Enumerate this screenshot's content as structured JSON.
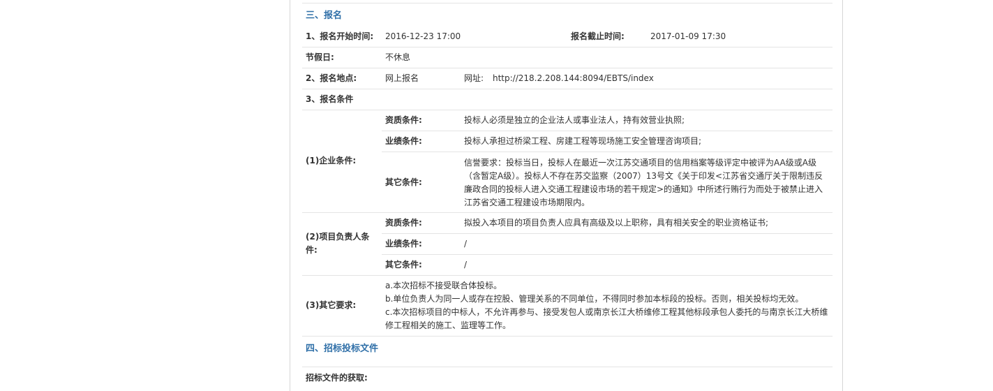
{
  "section3": {
    "title": "三、报名",
    "start_label": "1、报名开始时间:",
    "start_value": "2016-12-23 17:00",
    "end_label": "报名截止时间:",
    "end_value": "2017-01-09 17:30",
    "holiday_label": "节假日:",
    "holiday_value": "不休息",
    "place_label": "2、报名地点:",
    "place_value": "网上报名",
    "url_label": "网址:",
    "url_value": "http://218.2.208.144:8094/EBTS/index",
    "conditions_label": "3、报名条件",
    "enterprise": {
      "label": "(1)企业条件:",
      "qual_label": "资质条件:",
      "qual_value": "投标人必须是独立的企业法人或事业法人，持有效营业执照;",
      "perf_label": "业绩条件:",
      "perf_value": "投标人承担过桥梁工程、房建工程等现场施工安全管理咨询项目;",
      "other_label": "其它条件:",
      "other_value": "信誉要求：投标当日，投标人在最近一次江苏交通项目的信用档案等级评定中被评为AA级或A级（含暂定A级）。投标人不存在苏交监察（2007）13号文《关于印发<江苏省交通厅关于限制违反廉政合同的投标人进入交通工程建设市场的若干规定>的通知》中所述行贿行为而处于被禁止进入江苏省交通工程建设市场期限内。"
    },
    "manager": {
      "label": "(2)项目负责人条件:",
      "qual_label": "资质条件:",
      "qual_value": "拟投入本项目的项目负责人应具有高级及以上职称，具有相关安全的职业资格证书;",
      "perf_label": "业绩条件:",
      "perf_value": "/",
      "other_label": "其它条件:",
      "other_value": "/"
    },
    "other_req": {
      "label": "(3)其它要求:",
      "line_a": "a.本次招标不接受联合体投标。",
      "line_b": "b.单位负责人为同一人或存在控股、管理关系的不同单位，不得同时参加本标段的投标。否则，相关投标均无效。",
      "line_c": "c.本次招标项目的中标人，不允许再参与、接受发包人或南京长江大桥维修工程其他标段承包人委托的与南京长江大桥维修工程相关的施工、监理等工作。"
    }
  },
  "section4": {
    "title": "四、招标投标文件",
    "doc_label": "招标文件的获取:"
  }
}
